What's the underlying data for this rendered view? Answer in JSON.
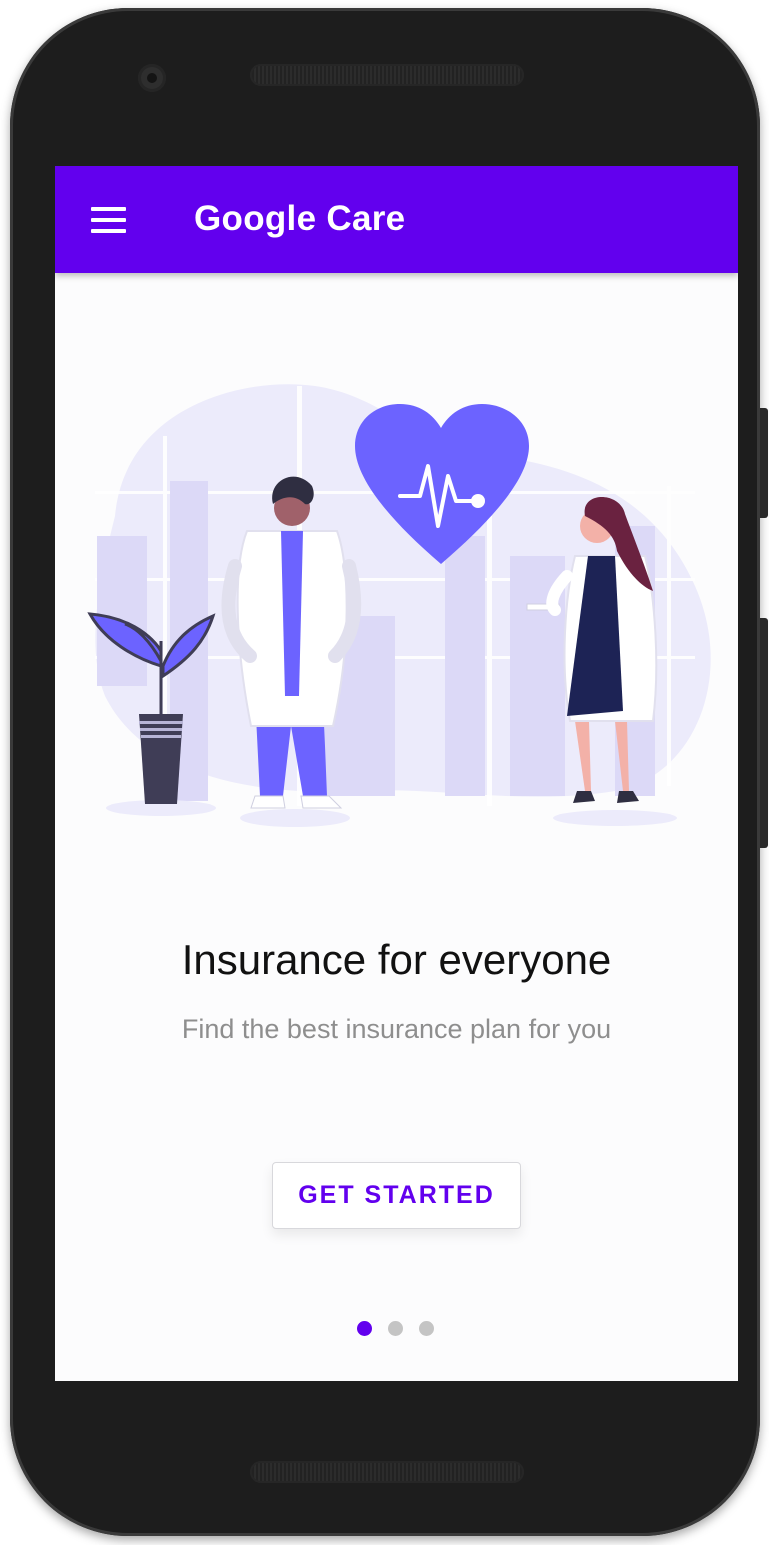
{
  "appbar": {
    "title": "Google Care",
    "menu_icon": "menu-icon"
  },
  "onboarding": {
    "headline": "Insurance for everyone",
    "subtitle": "Find the best insurance plan for you",
    "cta_label": "GET STARTED",
    "illustration": "doctors-heart-illustration",
    "page_indicator": {
      "total": 3,
      "active_index": 0
    }
  },
  "colors": {
    "primary": "#6200ee",
    "illustration_accent": "#6c63ff",
    "illustration_light": "#ece9fb",
    "dot_inactive": "#c4c4c4",
    "phone_frame": "#1d1d1d"
  }
}
